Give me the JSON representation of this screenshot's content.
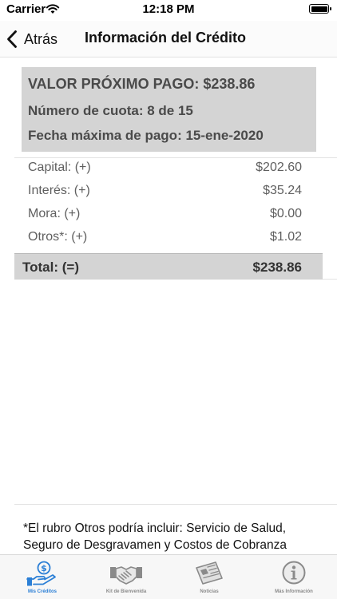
{
  "status_bar": {
    "carrier": "Carrier",
    "time": "12:18 PM"
  },
  "nav": {
    "back_label": "Atrás",
    "title": "Información del Crédito"
  },
  "summary": {
    "next_payment": "VALOR PRÓXIMO PAGO: $238.86",
    "installment": "Número de cuota: 8 de 15",
    "due_date": "Fecha máxima de pago: 15-ene-2020"
  },
  "breakdown": [
    {
      "label": "Capital: (+)",
      "value": "$202.60"
    },
    {
      "label": "Interés: (+)",
      "value": "$35.24"
    },
    {
      "label": "Mora: (+)",
      "value": "$0.00"
    },
    {
      "label": "Otros*: (+)",
      "value": "$1.02"
    }
  ],
  "total": {
    "label": "Total: (=)",
    "value": "$238.86"
  },
  "footnote": "*El rubro Otros podría incluir: Servicio de Salud, Seguro de Desgravamen y Costos de Cobranza",
  "tabs": [
    {
      "label": "Mis Créditos",
      "icon": "hand-money-icon",
      "active": true
    },
    {
      "label": "Kit de Bienvenida",
      "icon": "handshake-icon",
      "active": false
    },
    {
      "label": "Noticias",
      "icon": "newspaper-icon",
      "active": false
    },
    {
      "label": "Más Información",
      "icon": "info-icon",
      "active": false
    }
  ],
  "colors": {
    "accent": "#2b7fd6",
    "summary_bg": "#d4d4d4",
    "inactive_tab": "#8a8a8a"
  }
}
